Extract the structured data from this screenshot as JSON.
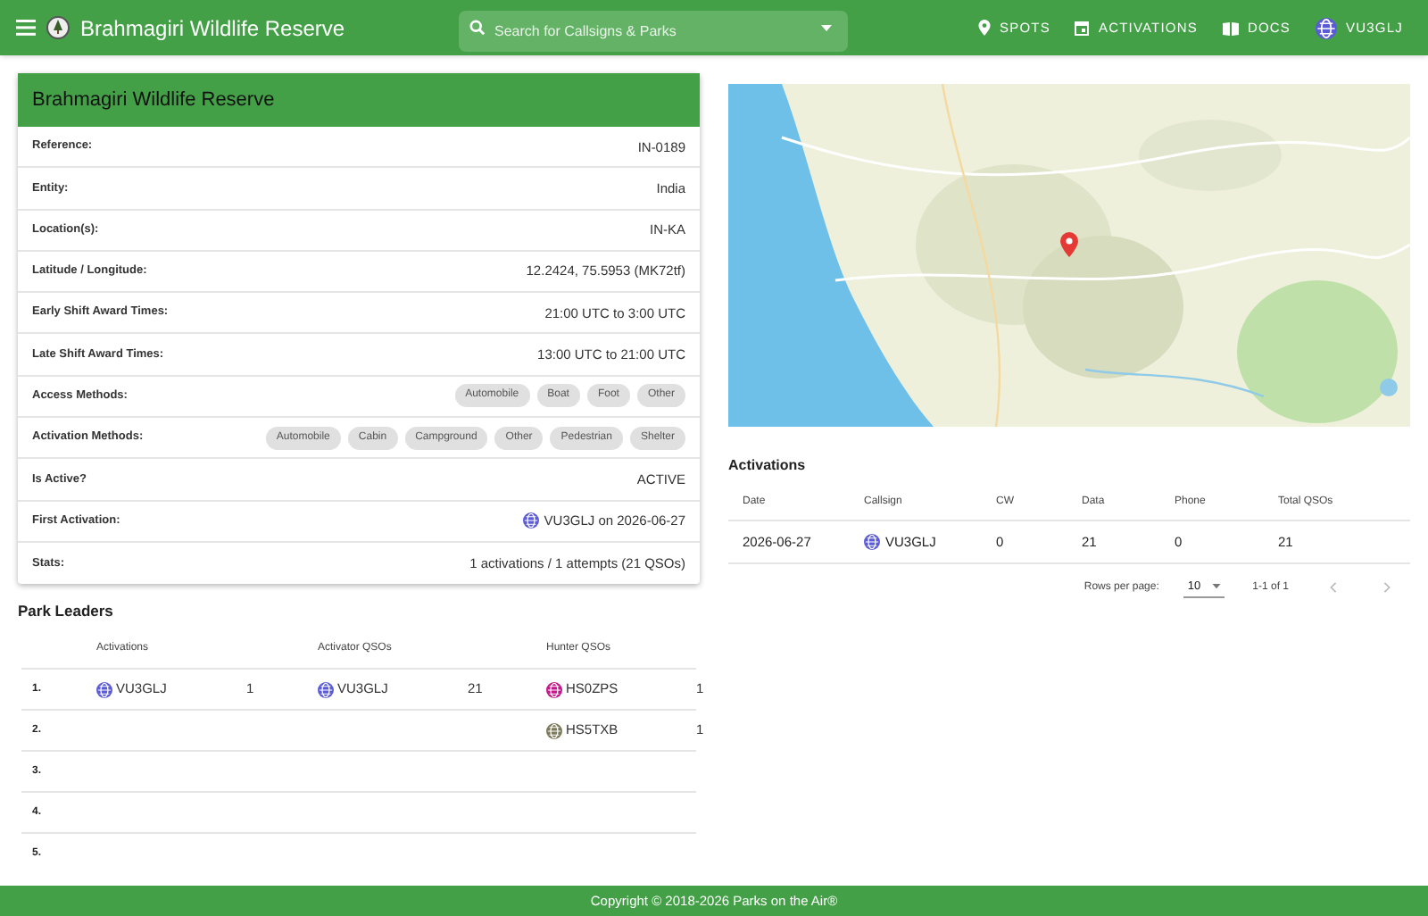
{
  "app_bar": {
    "title": "Brahmagiri Wildlife Reserve",
    "search": {
      "placeholder": "Search for Callsigns & Parks"
    },
    "nav": [
      {
        "label": "SPOTS",
        "kind": "pin"
      },
      {
        "label": "ACTIVATIONS",
        "kind": "calendar"
      },
      {
        "label": "DOCS",
        "kind": "book"
      },
      {
        "label": "VU3GLJ",
        "kind": "avatar",
        "color": "#5b5bd6"
      }
    ]
  },
  "park": {
    "title": "Brahmagiri Wildlife Reserve",
    "fields": [
      {
        "label": "Reference:",
        "kind": "text",
        "value": "IN-0189"
      },
      {
        "label": "Entity:",
        "kind": "text",
        "value": "India"
      },
      {
        "label": "Location(s):",
        "kind": "text",
        "value": "IN-KA"
      },
      {
        "label": "Latitude / Longitude:",
        "kind": "text",
        "value": "12.2424, 75.5953 (MK72tf)"
      },
      {
        "label": "Early Shift Award Times:",
        "kind": "text",
        "value": "21:00 UTC to 3:00 UTC"
      },
      {
        "label": "Late Shift Award Times:",
        "kind": "text",
        "value": "13:00 UTC to 21:00 UTC"
      },
      {
        "label": "Access Methods:",
        "kind": "chips",
        "chips": [
          "Automobile",
          "Boat",
          "Foot",
          "Other"
        ]
      },
      {
        "label": "Activation Methods:",
        "kind": "chips",
        "chips": [
          "Automobile",
          "Cabin",
          "Campground",
          "Other",
          "Pedestrian",
          "Shelter"
        ]
      },
      {
        "label": "Is Active?",
        "kind": "text",
        "value": "ACTIVE"
      },
      {
        "label": "First Activation:",
        "kind": "callsign",
        "value": "VU3GLJ on 2026-06-27",
        "color": "#5b5bd6"
      },
      {
        "label": "Stats:",
        "kind": "text",
        "value": "1 activations / 1 attempts (21 QSOs)"
      }
    ]
  },
  "park_leaders": {
    "title": "Park Leaders",
    "columns": [
      "Activations",
      "Activator QSOs",
      "Hunter QSOs"
    ],
    "rows": [
      {
        "rank": "1.",
        "activations": {
          "callsign": "VU3GLJ",
          "count": "1",
          "color": "#5b5bd6"
        },
        "activator_qsos": {
          "callsign": "VU3GLJ",
          "count": "21",
          "color": "#5b5bd6"
        },
        "hunter_qsos": {
          "callsign": "HS0ZPS",
          "count": "1",
          "color": "#c2188b"
        }
      },
      {
        "rank": "2.",
        "hunter_qsos": {
          "callsign": "HS5TXB",
          "count": "1",
          "color": "#7d7a5c"
        }
      },
      {
        "rank": "3."
      },
      {
        "rank": "4."
      },
      {
        "rank": "5."
      }
    ]
  },
  "activations": {
    "title": "Activations",
    "columns": [
      "Date",
      "Callsign",
      "CW",
      "Data",
      "Phone",
      "Total QSOs"
    ],
    "rows": [
      {
        "date": "2026-06-27",
        "callsign": "VU3GLJ",
        "color": "#5b5bd6",
        "cw": "0",
        "data": "21",
        "phone": "0",
        "total": "21"
      }
    ],
    "pagination": {
      "label": "Rows per page:",
      "rows_per_page": "10",
      "range": "1-1 of 1"
    }
  },
  "footer": "Copyright © 2018-2026 Parks on the Air®"
}
